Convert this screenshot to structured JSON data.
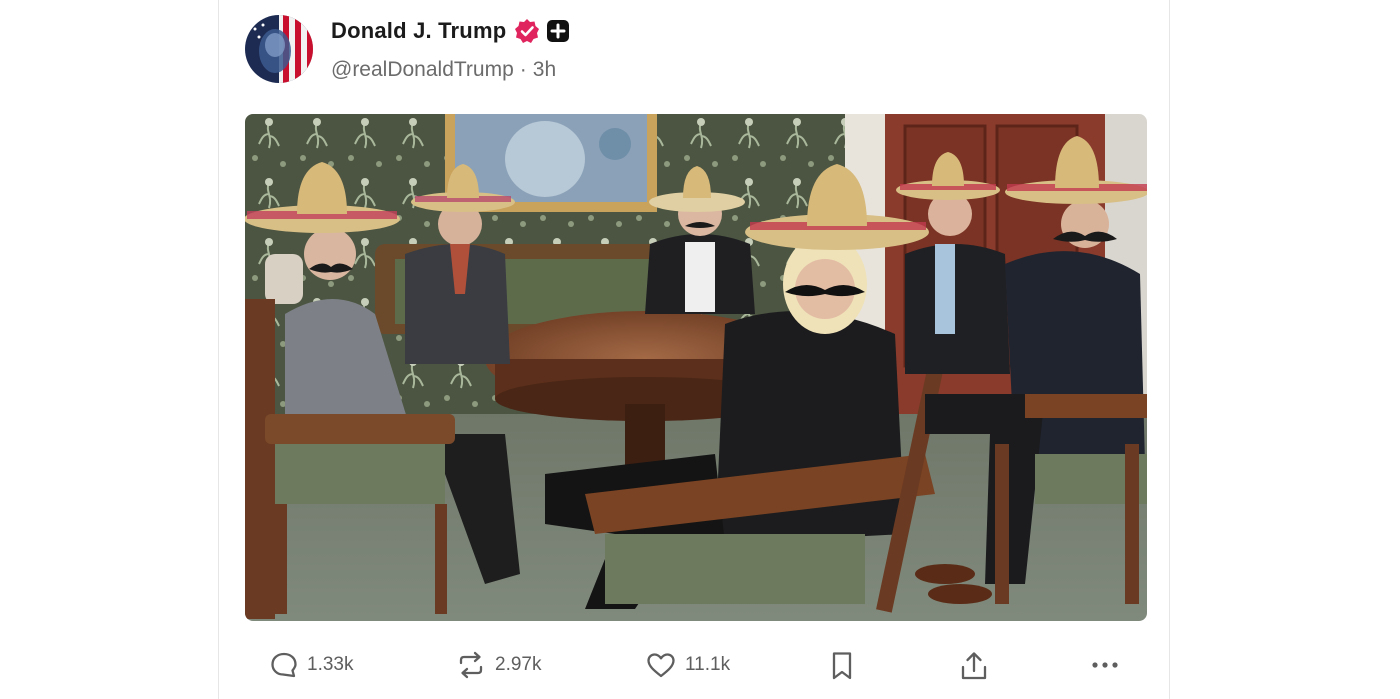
{
  "post": {
    "author": {
      "display_name": "Donald J. Trump",
      "handle": "@realDonaldTrump",
      "time": "3h",
      "verified_icon": "verified-badge-icon",
      "subscriber_icon": "plus-badge-icon"
    },
    "media": {
      "kind": "photo"
    },
    "actions": {
      "replies": "1.33k",
      "reposts": "2.97k",
      "likes": "11.1k"
    }
  },
  "colors": {
    "verified": "#e0245e",
    "muted_text": "#6b6b6b",
    "border": "#e6e6e6"
  }
}
